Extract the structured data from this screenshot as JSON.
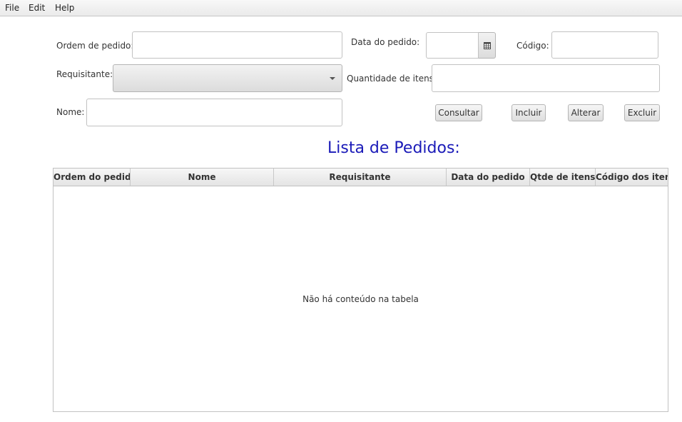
{
  "menu": [
    "File",
    "Edit",
    "Help"
  ],
  "form": {
    "ordem_label": "Ordem de pedido:",
    "ordem_value": "",
    "requisitante_label": "Requisitante:",
    "requisitante_value": "",
    "nome_label": "Nome:",
    "nome_value": "",
    "data_label": "Data do pedido:",
    "data_value": "",
    "codigo_label": "Código:",
    "codigo_value": "",
    "quantidade_label": "Quantidade de itens:",
    "quantidade_value": ""
  },
  "buttons": {
    "consultar": "Consultar",
    "incluir": "Incluir",
    "alterar": "Alterar",
    "excluir": "Excluir"
  },
  "list_title": "Lista de Pedidos:",
  "table": {
    "columns": [
      "Ordem do pedido",
      "Nome",
      "Requisitante",
      "Data do pedido",
      "Qtde de itens",
      "Código dos itens"
    ],
    "rows": [],
    "empty_message": "Não há conteúdo na tabela"
  },
  "icons": {
    "calendar": "calendar-icon",
    "dropdown": "chevron-down-icon"
  }
}
